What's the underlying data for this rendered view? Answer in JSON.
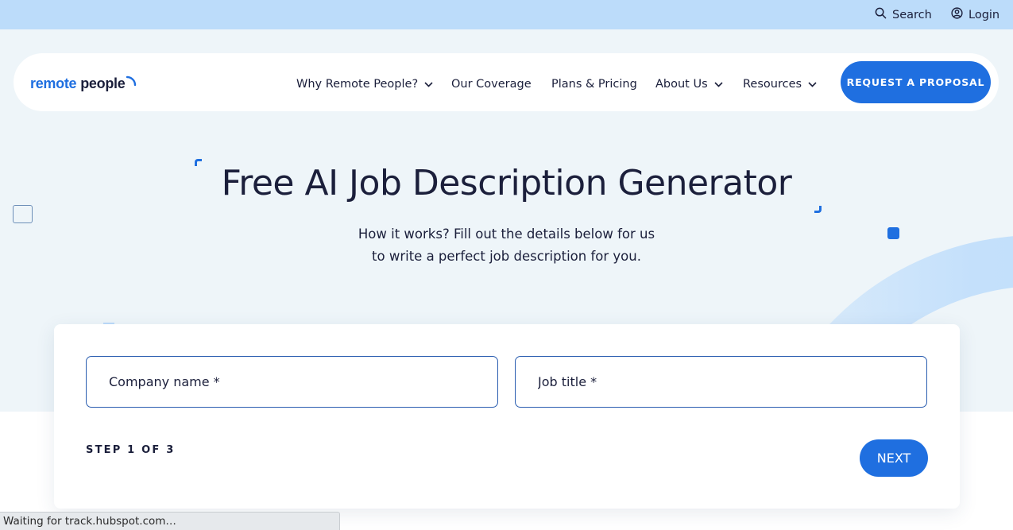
{
  "topbar": {
    "search_label": "Search",
    "login_label": "Login"
  },
  "nav": {
    "logo": {
      "part1": "remote",
      "part2": "people"
    },
    "items": [
      {
        "label": "Why Remote People?",
        "has_dropdown": true
      },
      {
        "label": "Our Coverage",
        "has_dropdown": false
      },
      {
        "label": "Plans & Pricing",
        "has_dropdown": false
      },
      {
        "label": "About Us",
        "has_dropdown": true
      },
      {
        "label": "Resources",
        "has_dropdown": true
      }
    ],
    "cta_label": "REQUEST A PROPOSAL"
  },
  "hero": {
    "title": "Free AI Job Description Generator",
    "subtitle_line1": "How it works? Fill out the details below for us",
    "subtitle_line2": "to write a perfect job description for you."
  },
  "form": {
    "company_placeholder": "Company name *",
    "job_title_placeholder": "Job title *",
    "step_text": "STEP 1 OF 3",
    "next_label": "NEXT"
  },
  "status_bar": {
    "text": "Waiting for track.hubspot.com…"
  },
  "colors": {
    "accent": "#1f6fe0",
    "topbar_bg": "#bcdcfa",
    "hero_bg": "#eef5f9",
    "text": "#1b1f3b"
  }
}
